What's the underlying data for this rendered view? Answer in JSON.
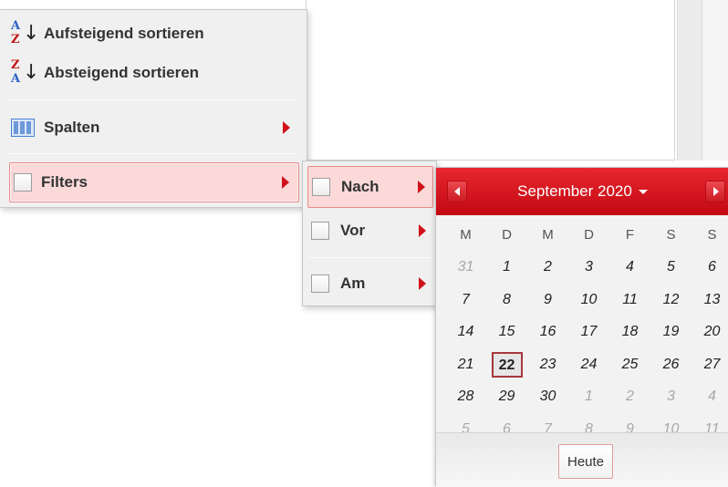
{
  "menu": {
    "sort_asc": "Aufsteigend sortieren",
    "sort_desc": "Absteigend sortieren",
    "columns": "Spalten",
    "filters": "Filters",
    "sort_asc_icon": [
      "A",
      "Z"
    ],
    "sort_desc_icon": [
      "Z",
      "A"
    ]
  },
  "submenu": {
    "after": "Nach",
    "before": "Vor",
    "on": "Am"
  },
  "datepicker": {
    "title": "September 2020",
    "weekdays": [
      "M",
      "D",
      "M",
      "D",
      "F",
      "S",
      "S"
    ],
    "weeks": [
      [
        {
          "d": "31",
          "o": true
        },
        {
          "d": "1"
        },
        {
          "d": "2"
        },
        {
          "d": "3"
        },
        {
          "d": "4"
        },
        {
          "d": "5"
        },
        {
          "d": "6"
        }
      ],
      [
        {
          "d": "7"
        },
        {
          "d": "8"
        },
        {
          "d": "9"
        },
        {
          "d": "10"
        },
        {
          "d": "11"
        },
        {
          "d": "12"
        },
        {
          "d": "13"
        }
      ],
      [
        {
          "d": "14"
        },
        {
          "d": "15"
        },
        {
          "d": "16"
        },
        {
          "d": "17"
        },
        {
          "d": "18"
        },
        {
          "d": "19"
        },
        {
          "d": "20"
        }
      ],
      [
        {
          "d": "21"
        },
        {
          "d": "22",
          "t": true
        },
        {
          "d": "23"
        },
        {
          "d": "24"
        },
        {
          "d": "25"
        },
        {
          "d": "26"
        },
        {
          "d": "27"
        }
      ],
      [
        {
          "d": "28"
        },
        {
          "d": "29"
        },
        {
          "d": "30"
        },
        {
          "d": "1",
          "o": true
        },
        {
          "d": "2",
          "o": true
        },
        {
          "d": "3",
          "o": true
        },
        {
          "d": "4",
          "o": true
        }
      ],
      [
        {
          "d": "5",
          "o": true
        },
        {
          "d": "6",
          "o": true
        },
        {
          "d": "7",
          "o": true
        },
        {
          "d": "8",
          "o": true
        },
        {
          "d": "9",
          "o": true
        },
        {
          "d": "10",
          "o": true
        },
        {
          "d": "11",
          "o": true
        }
      ]
    ],
    "today_button": "Heute",
    "accent_color": "#d4121b"
  }
}
